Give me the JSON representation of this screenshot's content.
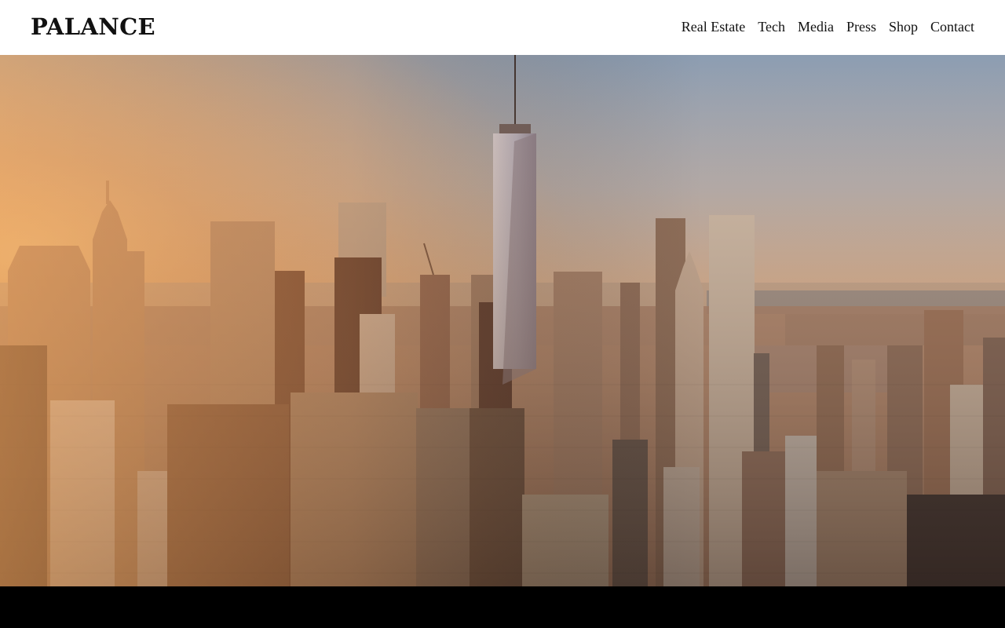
{
  "site": {
    "logo": "PALANCE"
  },
  "nav": {
    "items": [
      {
        "label": "Real Estate",
        "name": "nav-link-real-estate"
      },
      {
        "label": "Tech",
        "name": "nav-link-tech"
      },
      {
        "label": "Media",
        "name": "nav-link-media"
      },
      {
        "label": "Press",
        "name": "nav-link-press"
      },
      {
        "label": "Shop",
        "name": "nav-link-shop"
      },
      {
        "label": "Contact",
        "name": "nav-link-contact"
      }
    ]
  },
  "hero": {
    "image": "city-skyline-sunset",
    "colors": {
      "sky_top": "#8a9cb4",
      "sky_mid": "#c7b2a3",
      "sky_horizon": "#e2b78c",
      "sun_glow": "#f7c27a",
      "water": "#9fa8b0",
      "building_dark": "#3a2a22",
      "building_mid": "#7a5a44",
      "building_light": "#b8906c"
    }
  }
}
